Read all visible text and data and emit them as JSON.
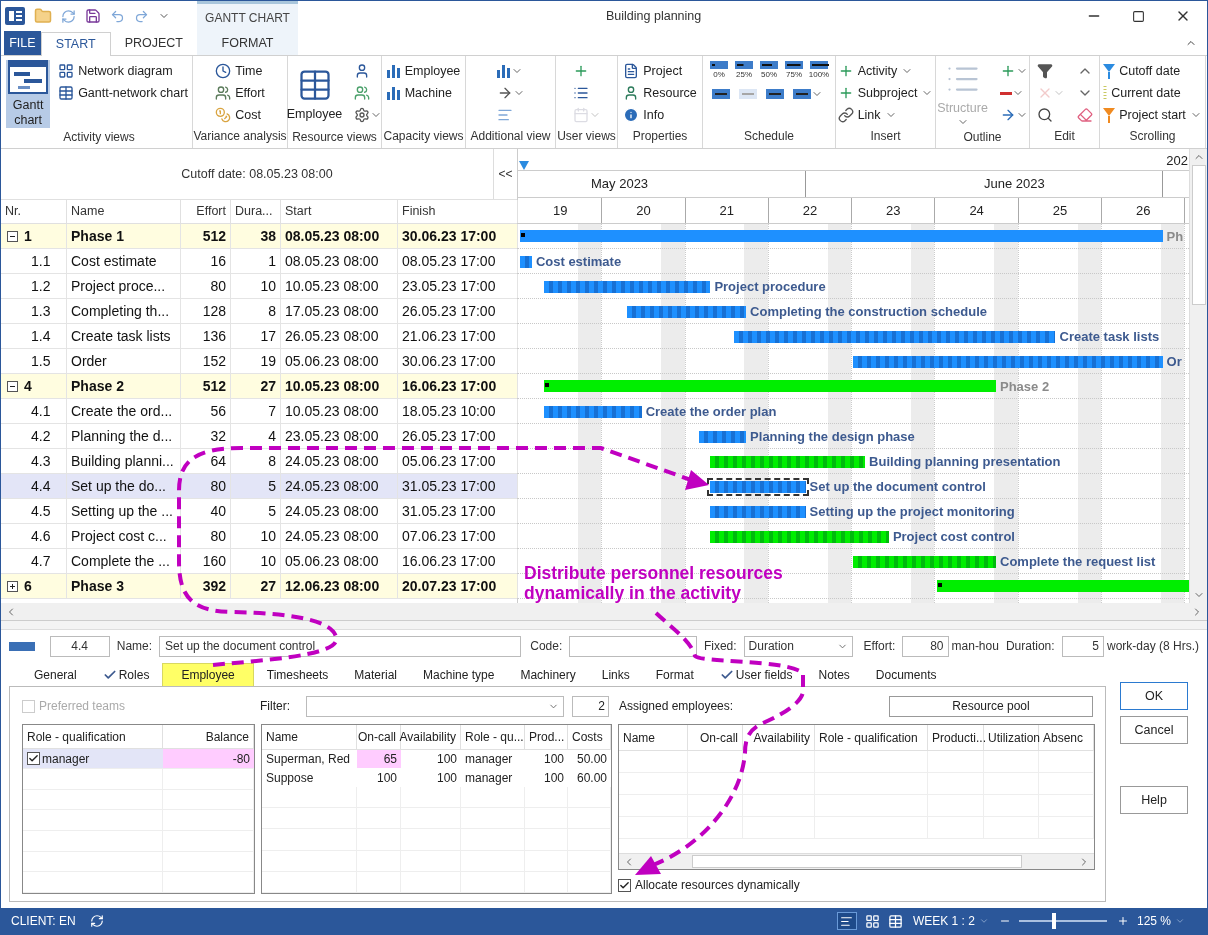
{
  "window": {
    "title": "Building planning"
  },
  "ribbon_tabs": [
    {
      "label": "FILE",
      "kind": "file",
      "selected": false
    },
    {
      "label": "START",
      "kind": "tab",
      "selected": true
    },
    {
      "label": "PROJECT",
      "kind": "tab",
      "selected": false
    }
  ],
  "context_tabs": {
    "title": "GANTT CHART",
    "tabs": [
      {
        "label": "FORMAT",
        "selected": false
      }
    ]
  },
  "ribbon": [
    {
      "label": "Activity views",
      "items": [
        {
          "kind": "large",
          "label": "Gantt chart",
          "selected": true
        },
        {
          "kind": "small",
          "label": "Network diagram",
          "selected": false
        },
        {
          "kind": "small",
          "label": "Gantt-network chart",
          "selected": false
        }
      ]
    },
    {
      "label": "Variance analysis",
      "items": [
        {
          "kind": "small",
          "label": "Time"
        },
        {
          "kind": "small",
          "label": "Effort"
        },
        {
          "kind": "small",
          "label": "Cost"
        }
      ]
    },
    {
      "label": "Resource views",
      "items": [
        {
          "kind": "large",
          "label": "Employee"
        },
        {
          "kind": "icon"
        },
        {
          "kind": "icon"
        },
        {
          "kind": "icon",
          "dropdown": true
        }
      ]
    },
    {
      "label": "Capacity views",
      "items": [
        {
          "kind": "small",
          "label": "Employee"
        },
        {
          "kind": "small",
          "label": "Machine"
        }
      ]
    },
    {
      "label": "Additional view",
      "items": [
        {
          "kind": "icon",
          "dropdown": true
        },
        {
          "kind": "icon",
          "dropdown": true
        },
        {
          "kind": "icon"
        }
      ]
    },
    {
      "label": "User views",
      "items": [
        {
          "kind": "icon"
        },
        {
          "kind": "icon"
        },
        {
          "kind": "icon",
          "dropdown": true,
          "disabled": true
        }
      ]
    },
    {
      "label": "Properties",
      "items": [
        {
          "kind": "small",
          "label": "Project"
        },
        {
          "kind": "small",
          "label": "Resource"
        },
        {
          "kind": "small",
          "label": "Info"
        }
      ]
    },
    {
      "label": "Schedule",
      "items": [
        {
          "kind": "percent",
          "label": "0%"
        },
        {
          "kind": "percent",
          "label": "25%"
        },
        {
          "kind": "percent",
          "label": "50%"
        },
        {
          "kind": "percent",
          "label": "75%"
        },
        {
          "kind": "percent",
          "label": "100%"
        },
        {
          "kind": "icon"
        },
        {
          "kind": "icon",
          "disabled": true
        },
        {
          "kind": "icon"
        },
        {
          "kind": "icon",
          "dropdown": true
        }
      ]
    },
    {
      "label": "Insert",
      "items": [
        {
          "kind": "small",
          "label": "Activity",
          "dropdown": true
        },
        {
          "kind": "small",
          "label": "Subproject",
          "dropdown": true
        },
        {
          "kind": "small",
          "label": "Link",
          "dropdown": true
        }
      ]
    },
    {
      "label": "Outline",
      "items": [
        {
          "kind": "large",
          "label": "Structure",
          "disabled": true,
          "dropdown": true
        },
        {
          "kind": "icon",
          "dropdown": true
        },
        {
          "kind": "icon",
          "dropdown": true
        },
        {
          "kind": "icon",
          "dropdown": true
        }
      ]
    },
    {
      "label": "Edit",
      "items": [
        {
          "kind": "icon"
        },
        {
          "kind": "icon",
          "dropdown": true,
          "disabled": true
        },
        {
          "kind": "icon"
        },
        {
          "kind": "icon"
        },
        {
          "kind": "icon"
        },
        {
          "kind": "icon"
        }
      ]
    },
    {
      "label": "Scrolling",
      "items": [
        {
          "kind": "small",
          "label": "Cutoff date"
        },
        {
          "kind": "small",
          "label": "Current date"
        },
        {
          "kind": "small",
          "label": "Project start",
          "dropdown": true
        }
      ]
    }
  ],
  "cutoff": "Cutoff date: 08.05.23 08:00",
  "collapse_button": "<<",
  "columns": [
    "Nr.",
    "Name",
    "Effort",
    "Dura...",
    "Start",
    "Finish"
  ],
  "rows": [
    {
      "nr": "1",
      "kind": "summary",
      "expanded": true,
      "name": "Phase 1",
      "effort": "512",
      "duration": "38",
      "start": "08.05.23 08:00",
      "finish": "30.06.23 17:00",
      "selected": false,
      "color": "#1e90ff",
      "bar_label": "Ph"
    },
    {
      "nr": "1.1",
      "kind": "task",
      "name": "Cost estimate",
      "effort": "16",
      "duration": "1",
      "start": "08.05.23 08:00",
      "finish": "08.05.23 17:00",
      "selected": false,
      "color": "#1e90ff",
      "bar_label": "Cost estimate"
    },
    {
      "nr": "1.2",
      "kind": "task",
      "name": "Project proce...",
      "effort": "80",
      "duration": "10",
      "start": "10.05.23 08:00",
      "finish": "23.05.23 17:00",
      "selected": false,
      "color": "#1e90ff",
      "bar_label": "Project procedure"
    },
    {
      "nr": "1.3",
      "kind": "task",
      "name": "Completing th...",
      "effort": "128",
      "duration": "8",
      "start": "17.05.23 08:00",
      "finish": "26.05.23 17:00",
      "selected": false,
      "color": "#1e90ff",
      "bar_label": "Completing the construction schedule"
    },
    {
      "nr": "1.4",
      "kind": "task",
      "name": "Create task lists",
      "effort": "136",
      "duration": "17",
      "start": "26.05.23 08:00",
      "finish": "21.06.23 17:00",
      "selected": false,
      "color": "#1e90ff",
      "bar_label": "Create task lists"
    },
    {
      "nr": "1.5",
      "kind": "task",
      "name": "Order",
      "effort": "152",
      "duration": "19",
      "start": "05.06.23 08:00",
      "finish": "30.06.23 17:00",
      "selected": false,
      "color": "#1e90ff",
      "bar_label": "Or"
    },
    {
      "nr": "4",
      "kind": "summary",
      "expanded": true,
      "name": "Phase 2",
      "effort": "512",
      "duration": "27",
      "start": "10.05.23 08:00",
      "finish": "16.06.23 17:00",
      "selected": false,
      "color": "#00ee00",
      "bar_label": "Phase 2"
    },
    {
      "nr": "4.1",
      "kind": "task",
      "name": "Create the ord...",
      "effort": "56",
      "duration": "7",
      "start": "10.05.23 08:00",
      "finish": "18.05.23 10:00",
      "selected": false,
      "color": "#1e90ff",
      "bar_label": "Create the order plan"
    },
    {
      "nr": "4.2",
      "kind": "task",
      "name": "Planning the d...",
      "effort": "32",
      "duration": "4",
      "start": "23.05.23 08:00",
      "finish": "26.05.23 17:00",
      "selected": false,
      "color": "#1e90ff",
      "bar_label": "Planning the design phase"
    },
    {
      "nr": "4.3",
      "kind": "task",
      "name": "Building planni...",
      "effort": "64",
      "duration": "8",
      "start": "24.05.23 08:00",
      "finish": "05.06.23 17:00",
      "selected": false,
      "color": "#00ee00",
      "bar_label": "Building planning presentation"
    },
    {
      "nr": "4.4",
      "kind": "task",
      "name": "Set up the do...",
      "effort": "80",
      "duration": "5",
      "start": "24.05.23 08:00",
      "finish": "31.05.23 17:00",
      "selected": true,
      "color": "#1e90ff",
      "bar_label": "Set up the document control"
    },
    {
      "nr": "4.5",
      "kind": "task",
      "name": "Setting up the ...",
      "effort": "40",
      "duration": "5",
      "start": "24.05.23 08:00",
      "finish": "31.05.23 17:00",
      "selected": false,
      "color": "#1e90ff",
      "bar_label": "Setting up the project monitoring"
    },
    {
      "nr": "4.6",
      "kind": "task",
      "name": "Project cost c...",
      "effort": "80",
      "duration": "10",
      "start": "24.05.23 08:00",
      "finish": "07.06.23 17:00",
      "selected": false,
      "color": "#00ee00",
      "bar_label": "Project cost control"
    },
    {
      "nr": "4.7",
      "kind": "task",
      "name": "Complete the ...",
      "effort": "160",
      "duration": "10",
      "start": "05.06.23 08:00",
      "finish": "16.06.23 17:00",
      "selected": false,
      "color": "#00ee00",
      "bar_label": "Complete the request list"
    },
    {
      "nr": "6",
      "kind": "summary",
      "expanded": false,
      "name": "Phase 3",
      "effort": "392",
      "duration": "27",
      "start": "12.06.23 08:00",
      "finish": "20.07.23 17:00",
      "selected": false,
      "color": "#00ee00"
    }
  ],
  "gantt": {
    "year": "202",
    "months": [
      "May 2023",
      "June 2023"
    ],
    "weeks": [
      "19",
      "20",
      "21",
      "22",
      "23",
      "24",
      "25",
      "26"
    ]
  },
  "annotation": "Distribute personnel resources dynamically in the activity",
  "details": {
    "index": "4.4",
    "name_label": "Name:",
    "name": "Set up the document control",
    "code_label": "Code:",
    "fixed_label": "Fixed:",
    "fixed": "Duration",
    "effort_label": "Effort:",
    "effort": "80",
    "effort_unit": "man-hou",
    "duration_label": "Duration:",
    "duration": "5",
    "duration_unit": "work-day (8 Hrs.)",
    "tabs": [
      {
        "label": "General",
        "checked": false,
        "selected": false
      },
      {
        "label": "Roles",
        "checked": true,
        "selected": false
      },
      {
        "label": "Employee",
        "checked": false,
        "selected": true
      },
      {
        "label": "Timesheets",
        "checked": false,
        "selected": false
      },
      {
        "label": "Material",
        "checked": false,
        "selected": false
      },
      {
        "label": "Machine type",
        "checked": false,
        "selected": false
      },
      {
        "label": "Machinery",
        "checked": false,
        "selected": false
      },
      {
        "label": "Links",
        "checked": false,
        "selected": false
      },
      {
        "label": "Format",
        "checked": false,
        "selected": false
      },
      {
        "label": "User fields",
        "checked": true,
        "selected": false
      },
      {
        "label": "Notes",
        "checked": false,
        "selected": false
      },
      {
        "label": "Documents",
        "checked": false,
        "selected": false
      }
    ],
    "preferred_teams": {
      "label": "Preferred teams",
      "checked": false,
      "disabled": true
    },
    "filter_label": "Filter:",
    "filter_count": "2",
    "assigned_label": "Assigned employees:",
    "resource_pool": "Resource pool",
    "roles_table": {
      "columns": [
        "Role - qualification",
        "Balance"
      ],
      "rows": [
        {
          "role": "manager",
          "checked": true,
          "balance": "-80",
          "warning": true
        }
      ]
    },
    "employees_table": {
      "columns": [
        "Name",
        "On-call",
        "Availability",
        "Role - qu...",
        "Prod...",
        "Costs"
      ],
      "rows": [
        {
          "cells": [
            "Superman, Red",
            "65",
            "100",
            "manager",
            "100",
            "50.00"
          ],
          "warning": true
        },
        {
          "cells": [
            "Suppose",
            "100",
            "100",
            "manager",
            "100",
            "60.00"
          ],
          "warning": false
        }
      ]
    },
    "assigned_table": {
      "columns": [
        "Name",
        "On-call",
        "Availability",
        "Role - qualification",
        "Producti...",
        "Utilization",
        "Absenc"
      ]
    },
    "allocate": {
      "label": "Allocate resources dynamically",
      "checked": true
    },
    "buttons": [
      {
        "label": "OK",
        "kind": "primary"
      },
      {
        "label": "Cancel",
        "kind": "secondary"
      },
      {
        "label": "Help",
        "kind": "help"
      }
    ]
  },
  "status": {
    "client": "CLIENT: EN",
    "week": "WEEK 1 : 2",
    "zoom": "125 %",
    "zoom_slider": {
      "level": 0.4
    }
  }
}
